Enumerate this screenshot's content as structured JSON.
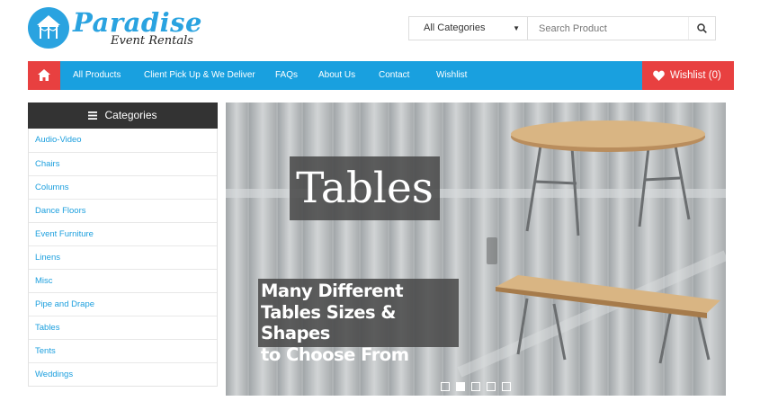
{
  "brand": {
    "name": "Paradise",
    "tagline": "Event Rentals"
  },
  "search": {
    "category": "All Categories",
    "placeholder": "Search Product"
  },
  "nav": {
    "items": [
      "All Products",
      "Client Pick Up & We Deliver",
      "FAQs",
      "About Us",
      "Contact",
      "Wishlist"
    ],
    "wishlist": "Wishlist (0)"
  },
  "sidebar": {
    "title": "Categories",
    "items": [
      "Audio-Video",
      "Chairs",
      "Columns",
      "Dance Floors",
      "Event Furniture",
      "Linens",
      "Misc",
      "Pipe and Drape",
      "Tables",
      "Tents",
      "Weddings"
    ]
  },
  "hero": {
    "title": "Tables",
    "subtitle_lines": [
      "Many Different",
      "Tables Sizes & Shapes",
      "to Choose From"
    ],
    "slide_count": 5,
    "active_slide": 2
  },
  "colors": {
    "accent": "#19a0df",
    "highlight": "#e84040",
    "dark": "#333333"
  }
}
